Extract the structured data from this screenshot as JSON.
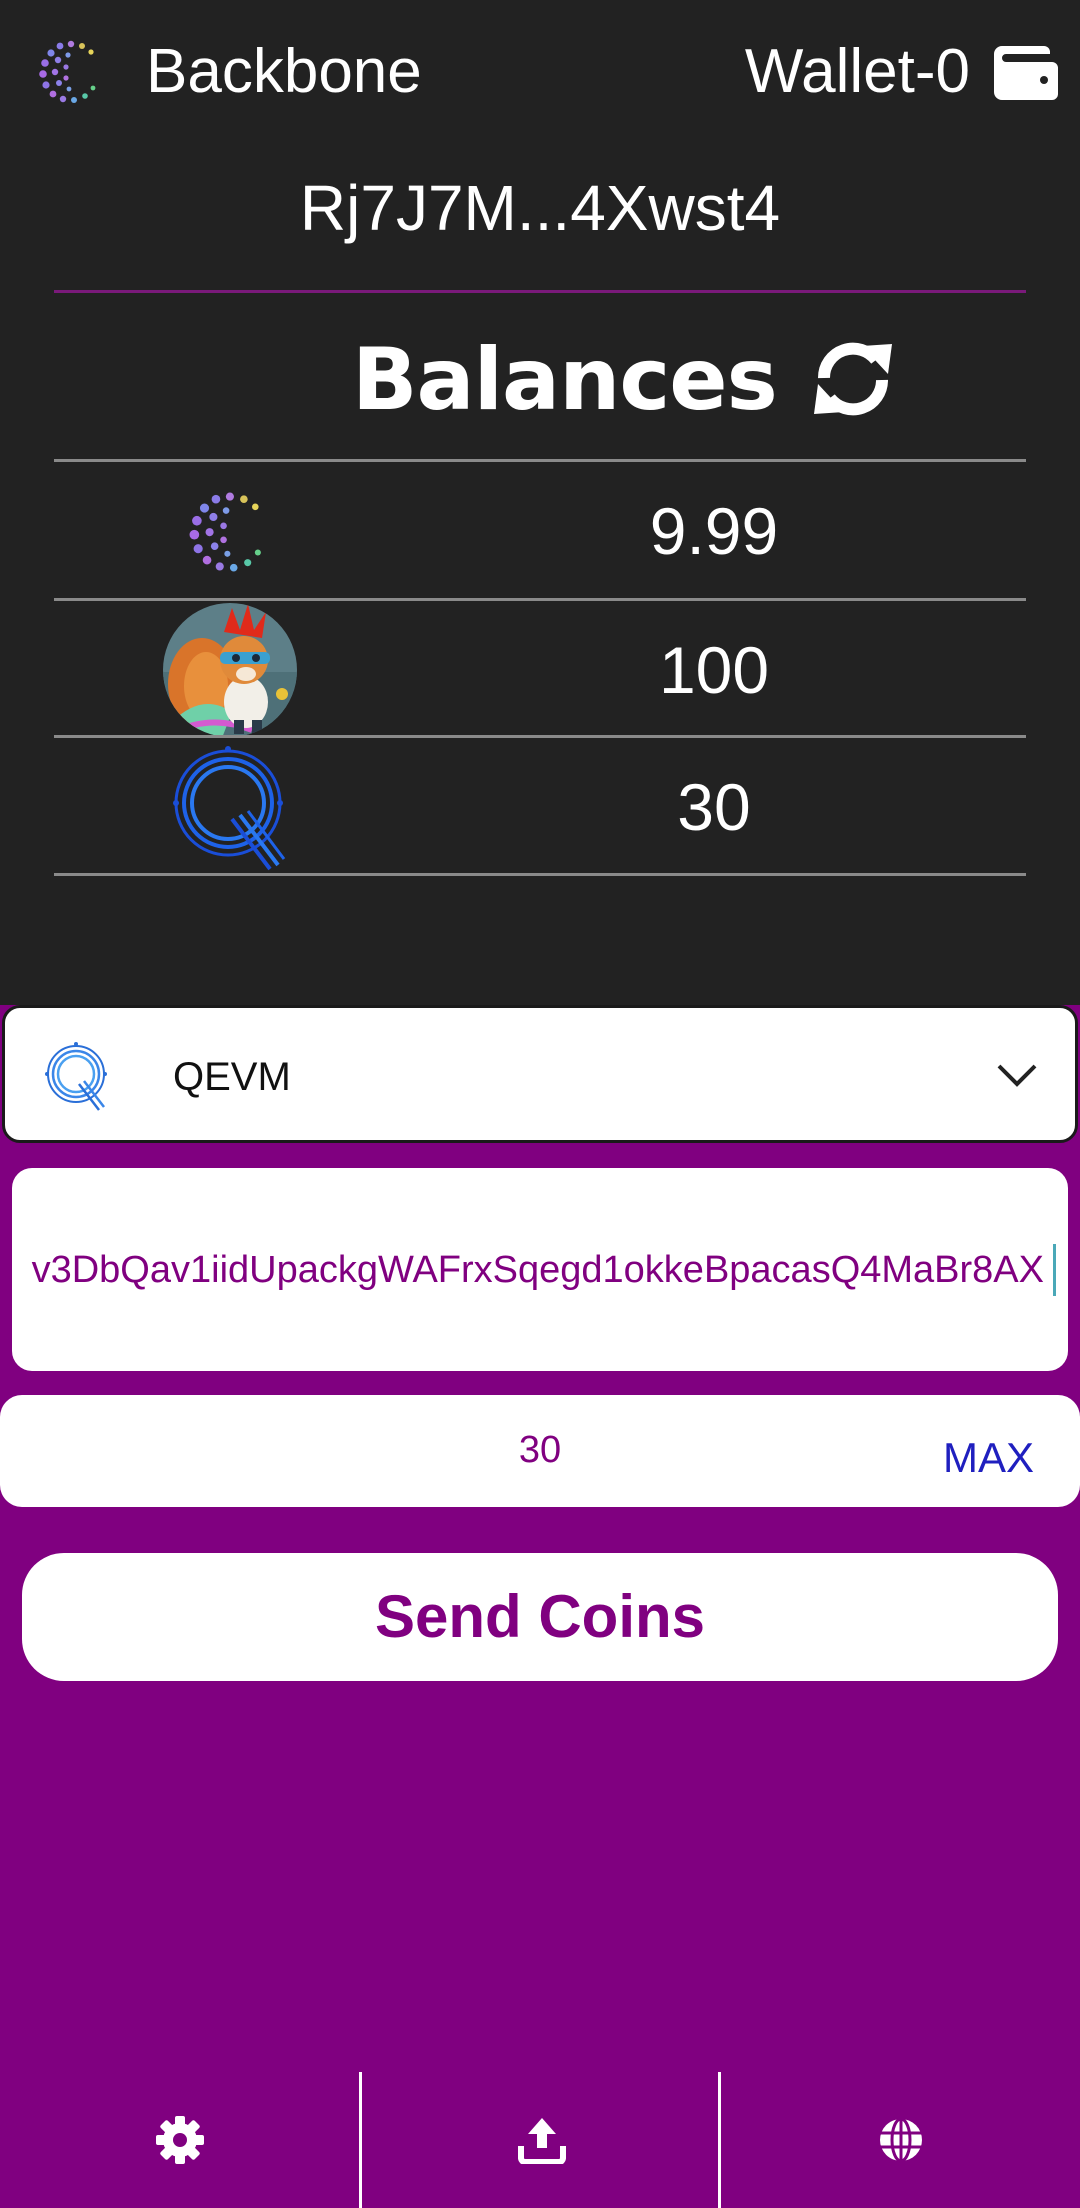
{
  "header": {
    "app_title": "Backbone",
    "wallet_name": "Wallet-0",
    "logo_icon": "backbone-logo",
    "wallet_icon": "wallet-icon"
  },
  "account": {
    "address_short": "Rj7J7M...4Xwst4"
  },
  "balances": {
    "title": "Balances",
    "refresh_icon": "refresh-icon",
    "tokens": [
      {
        "icon": "backbone-token-icon",
        "balance": "9.99"
      },
      {
        "icon": "squirrel-token-icon",
        "balance": "100"
      },
      {
        "icon": "qevm-token-icon",
        "balance": "30"
      }
    ]
  },
  "send_form": {
    "selected_token": "QEVM",
    "selected_token_icon": "qevm-token-icon",
    "recipient_address": "v3DbQav1iidUpackgWAFrxSqegd1okkeBpacasQ4MaBr8AX",
    "amount": "30",
    "max_label": "MAX",
    "send_label": "Send Coins"
  },
  "bottom_nav": [
    {
      "icon": "gear-icon"
    },
    {
      "icon": "upload-icon"
    },
    {
      "icon": "globe-icon"
    }
  ],
  "colors": {
    "primary": "#800080",
    "dark_bg": "#222222",
    "max_link": "#1f1fbf"
  }
}
